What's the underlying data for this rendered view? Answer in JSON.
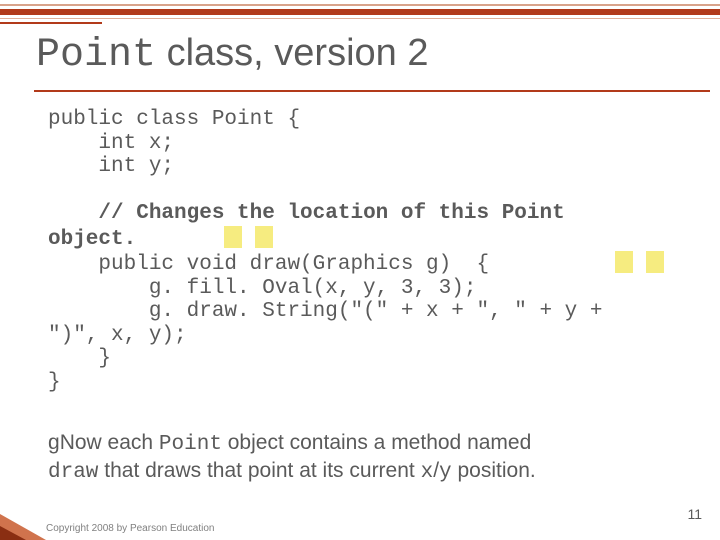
{
  "title": {
    "mono": "Point",
    "rest": " class, version 2"
  },
  "code": {
    "l1": "public class Point {",
    "l2": "    int x;",
    "l3": "    int y;",
    "blank": "",
    "l5a": "    ",
    "l5comment": "// Changes the location of this Point",
    "l6comment": "object.",
    "l7": "    public void draw(Graphics g)  {",
    "l8": "        g. fill. Oval(x, y, 3, 3);",
    "l9": "        g. draw. String(\"(\" + x + \", \" + y +",
    "l10": "\")\", x, y);",
    "l11": "    }",
    "l12": "}"
  },
  "body": {
    "bullet": "g",
    "t1": "Now each ",
    "mono1": "Point",
    "t2": " object contains a method named ",
    "mono2": "draw",
    "t3": " that draws that point at its current ",
    "mono3": "x",
    "slash": "/",
    "mono4": "y",
    "t4": " position."
  },
  "footer": "Copyright 2008 by Pearson Education",
  "pagenum": "11"
}
